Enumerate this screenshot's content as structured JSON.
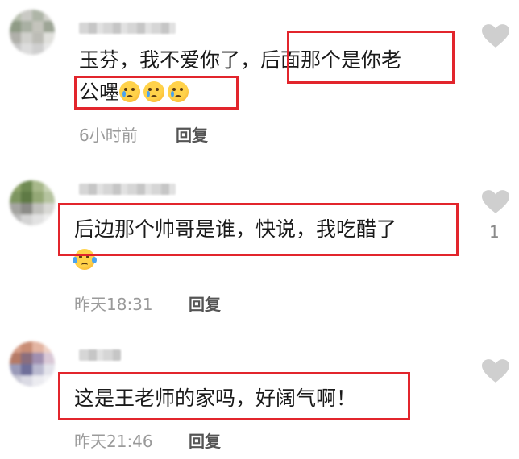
{
  "comments": [
    {
      "line1": "玉芬，我不爱你了，后面那个是你老",
      "line2": "公嚜",
      "line2_emojis": [
        "crying-face-icon",
        "crying-face-icon",
        "crying-face-icon"
      ],
      "time": "6小时前",
      "reply_label": "回复",
      "likes": ""
    },
    {
      "line1": "后边那个帅哥是谁，快说，我吃醋了",
      "line2_emojis": [
        "laughing-tears-icon"
      ],
      "time": "昨天18:31",
      "reply_label": "回复",
      "likes": "1"
    },
    {
      "line1": "这是王老师的家吗，好阔气啊！",
      "time": "昨天21:46",
      "reply_label": "回复",
      "likes": ""
    }
  ],
  "colors": {
    "highlight": "#e2252c",
    "heart": "#cfcfcf",
    "meta_text": "#9a9a9a"
  }
}
